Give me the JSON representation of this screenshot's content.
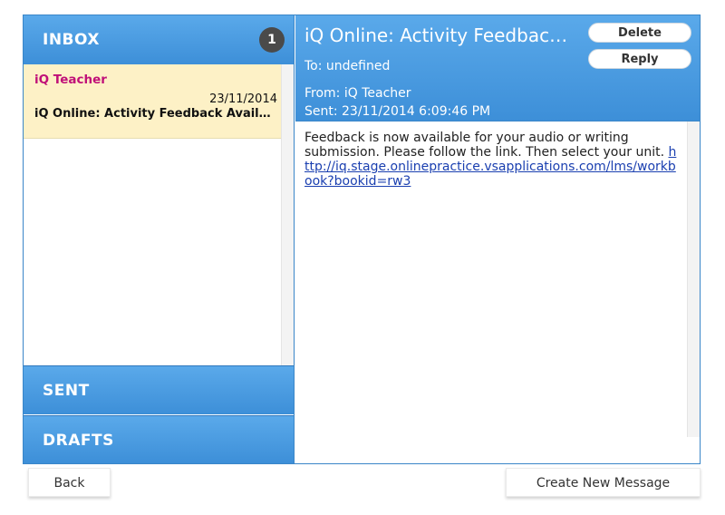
{
  "folders": {
    "inbox": {
      "label": "INBOX",
      "count": "1"
    },
    "sent": {
      "label": "SENT"
    },
    "drafts": {
      "label": "DRAFTS"
    }
  },
  "messages": [
    {
      "from": "iQ Teacher",
      "date": "23/11/2014",
      "subject": "iQ Online: Activity Feedback Availa..."
    }
  ],
  "reader": {
    "subject": "iQ Online: Activity Feedback A...",
    "to": "To: undefined",
    "from": "From: iQ Teacher",
    "sent": "Sent: 23/11/2014 6:09:46 PM",
    "body_text": "Feedback is now available for your audio or writing submission. Please follow the link. Then select your unit.",
    "link": "http://iq.stage.onlinepractice.vsapplications.com/lms/workbook?bookid=rw3",
    "delete_label": "Delete",
    "reply_label": "Reply"
  },
  "footer": {
    "back_label": "Back",
    "create_label": "Create New Message"
  },
  "colors": {
    "header_blue": "#4a9be0",
    "selected_row": "#fdf1c6",
    "sender_magenta": "#c01078",
    "badge_gray": "#4a4a4a"
  }
}
